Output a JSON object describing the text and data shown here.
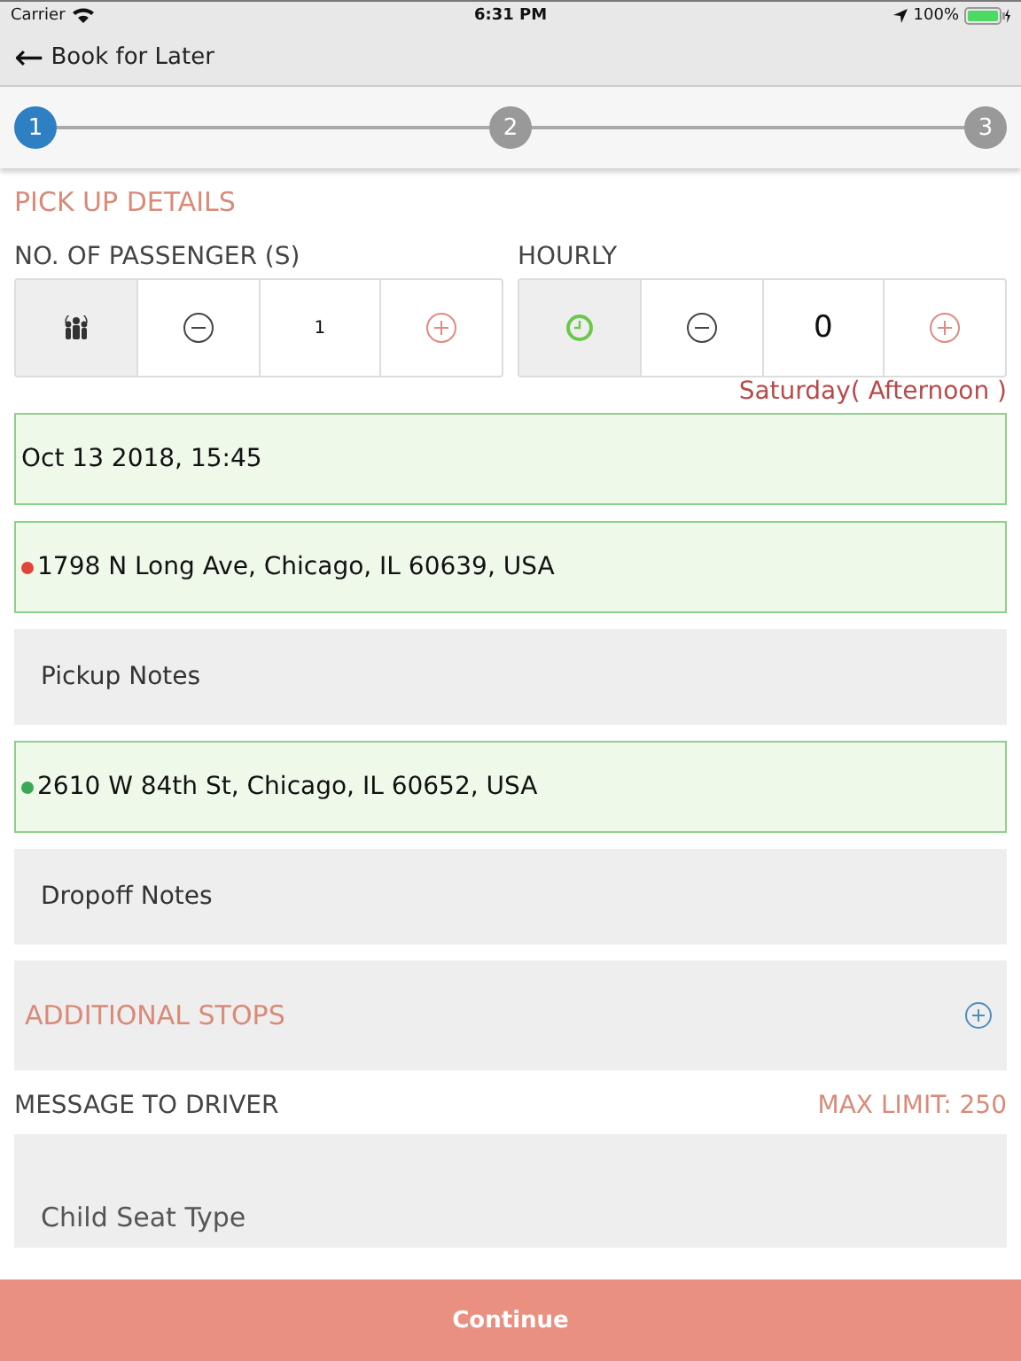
{
  "status_bar": {
    "carrier": "Carrier",
    "time": "6:31 PM",
    "battery": "100%"
  },
  "nav": {
    "back_icon": "←",
    "title": "Book for Later"
  },
  "steps": [
    {
      "label": "1",
      "selected": true
    },
    {
      "label": "2",
      "selected": false
    },
    {
      "label": "3",
      "selected": false
    }
  ],
  "section_title": "PICK UP DETAILS",
  "counters": [
    {
      "label": "NO. OF PASSENGER (S)",
      "kind": "people",
      "value": "1"
    },
    {
      "label": "HOURLY",
      "kind": "clock",
      "value": "0"
    }
  ],
  "day_note": "Saturday( Afternoon )",
  "fields": [
    {
      "kind": "filled",
      "value": "Oct 13 2018, 15:45"
    },
    {
      "kind": "filled",
      "color": "#e0443a",
      "value": "1798 N Long Ave, Chicago, IL 60639, USA"
    },
    {
      "kind": "empty",
      "placeholder": "Pickup Notes"
    },
    {
      "kind": "filled",
      "color": "#3aa856",
      "value": "2610 W 84th St, Chicago, IL 60652, USA"
    },
    {
      "kind": "empty",
      "placeholder": "Dropoff Notes"
    }
  ],
  "additional_stops": "ADDITIONAL STOPS",
  "message": {
    "label": "MESSAGE TO DRIVER",
    "limit": "MAX LIMIT: 250"
  },
  "child_seat": "Child Seat Type",
  "continue_button": "Continue"
}
